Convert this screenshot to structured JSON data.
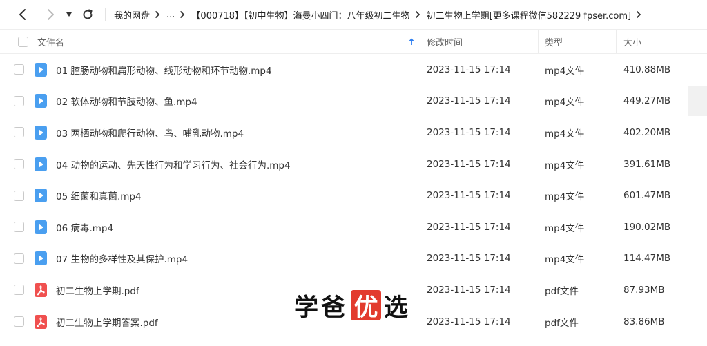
{
  "breadcrumb": [
    "我的网盘",
    "...",
    "【000718】【初中生物】海曼小四门：八年级初二生物",
    "初二生物上学期[更多课程微信582229 fpser.com]"
  ],
  "columns": {
    "name": "文件名",
    "modified": "修改时间",
    "type": "类型",
    "size": "大小"
  },
  "files": [
    {
      "name": "01 腔肠动物和扁形动物、线形动物和环节动物.mp4",
      "modified": "2023-11-15 17:14",
      "type": "mp4文件",
      "size": "410.88MB",
      "icon": "video-file-icon"
    },
    {
      "name": "02 软体动物和节肢动物、鱼.mp4",
      "modified": "2023-11-15 17:14",
      "type": "mp4文件",
      "size": "449.27MB",
      "icon": "video-file-icon"
    },
    {
      "name": "03 两栖动物和爬行动物、鸟、哺乳动物.mp4",
      "modified": "2023-11-15 17:14",
      "type": "mp4文件",
      "size": "402.20MB",
      "icon": "video-file-icon"
    },
    {
      "name": "04 动物的运动、先天性行为和学习行为、社会行为.mp4",
      "modified": "2023-11-15 17:14",
      "type": "mp4文件",
      "size": "391.61MB",
      "icon": "video-file-icon"
    },
    {
      "name": "05 细菌和真菌.mp4",
      "modified": "2023-11-15 17:14",
      "type": "mp4文件",
      "size": "601.47MB",
      "icon": "video-file-icon"
    },
    {
      "name": "06 病毒.mp4",
      "modified": "2023-11-15 17:14",
      "type": "mp4文件",
      "size": "190.02MB",
      "icon": "video-file-icon"
    },
    {
      "name": "07 生物的多样性及其保护.mp4",
      "modified": "2023-11-15 17:14",
      "type": "mp4文件",
      "size": "114.47MB",
      "icon": "video-file-icon"
    },
    {
      "name": "初二生物上学期.pdf",
      "modified": "2023-11-15 17:14",
      "type": "pdf文件",
      "size": "87.93MB",
      "icon": "pdf-file-icon"
    },
    {
      "name": "初二生物上学期答案.pdf",
      "modified": "2023-11-15 17:14",
      "type": "pdf文件",
      "size": "83.86MB",
      "icon": "pdf-file-icon"
    }
  ],
  "watermark": {
    "pre": "学爸",
    "highlight": "优",
    "post": "选"
  },
  "colors": {
    "video_icon": "#4a9ff0",
    "pdf_icon": "#f0504f",
    "watermark_accent": "#e23b2e"
  }
}
